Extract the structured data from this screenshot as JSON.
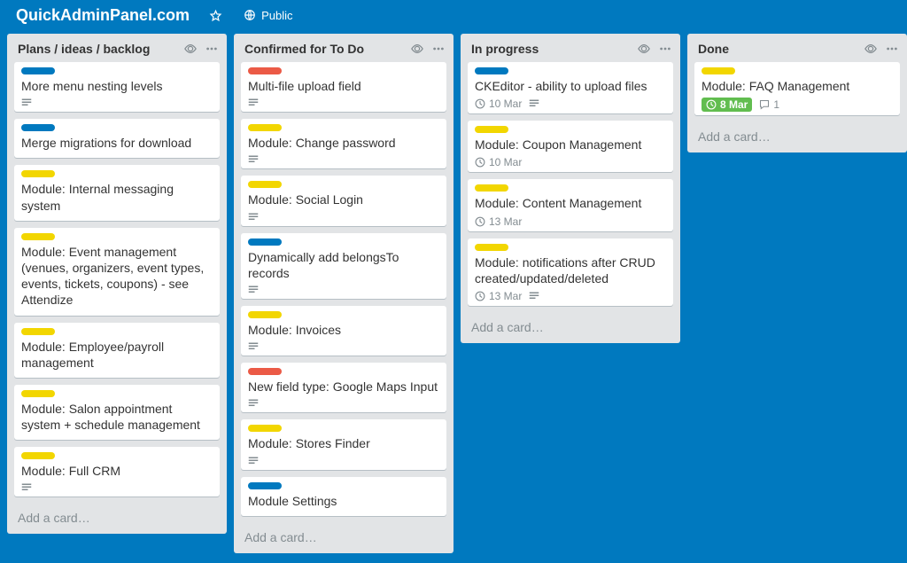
{
  "header": {
    "board_title": "QuickAdminPanel.com",
    "public_label": "Public"
  },
  "add_card_label": "Add a card…",
  "label_colors": {
    "blue": "#0079bf",
    "yellow": "#f2d600",
    "red": "#eb5a46",
    "green": "#61bd4f"
  },
  "lists": [
    {
      "title": "Plans / ideas / backlog",
      "cards": [
        {
          "labels": [
            "blue"
          ],
          "title": "More menu nesting levels",
          "has_desc": true
        },
        {
          "labels": [
            "blue"
          ],
          "title": "Merge migrations for download"
        },
        {
          "labels": [
            "yellow"
          ],
          "title": "Module: Internal messaging system"
        },
        {
          "labels": [
            "yellow"
          ],
          "title": "Module: Event management (venues, organizers, event types, events, tickets, coupons) - see Attendize"
        },
        {
          "labels": [
            "yellow"
          ],
          "title": "Module: Employee/payroll management"
        },
        {
          "labels": [
            "yellow"
          ],
          "title": "Module: Salon appointment system + schedule management"
        },
        {
          "labels": [
            "yellow"
          ],
          "title": "Module: Full CRM",
          "has_desc": true
        }
      ]
    },
    {
      "title": "Confirmed for To Do",
      "scroll": true,
      "cards": [
        {
          "labels": [
            "red"
          ],
          "title": "Multi-file upload field",
          "has_desc": true
        },
        {
          "labels": [
            "yellow"
          ],
          "title": "Module: Change password",
          "has_desc": true
        },
        {
          "labels": [
            "yellow"
          ],
          "title": "Module: Social Login",
          "has_desc": true
        },
        {
          "labels": [
            "blue"
          ],
          "title": "Dynamically add belongsTo records",
          "has_desc": true
        },
        {
          "labels": [
            "yellow"
          ],
          "title": "Module: Invoices",
          "has_desc": true
        },
        {
          "labels": [
            "red"
          ],
          "title": "New field type: Google Maps Input",
          "has_desc": true
        },
        {
          "labels": [
            "yellow"
          ],
          "title": "Module: Stores Finder",
          "has_desc": true
        },
        {
          "labels": [
            "blue"
          ],
          "title": "Module Settings"
        }
      ]
    },
    {
      "title": "In progress",
      "cards": [
        {
          "labels": [
            "blue"
          ],
          "title": "CKEditor - ability to upload files",
          "due": "10 Mar",
          "has_desc": true
        },
        {
          "labels": [
            "yellow"
          ],
          "title": "Module: Coupon Management",
          "due": "10 Mar"
        },
        {
          "labels": [
            "yellow"
          ],
          "title": "Module: Content Management",
          "due": "13 Mar"
        },
        {
          "labels": [
            "yellow"
          ],
          "title": "Module: notifications after CRUD created/updated/deleted",
          "due": "13 Mar",
          "has_desc": true
        }
      ]
    },
    {
      "title": "Done",
      "cards": [
        {
          "labels": [
            "yellow"
          ],
          "title": "Module: FAQ Management",
          "due": "8 Mar",
          "due_done": true,
          "comments": 1
        }
      ]
    }
  ]
}
